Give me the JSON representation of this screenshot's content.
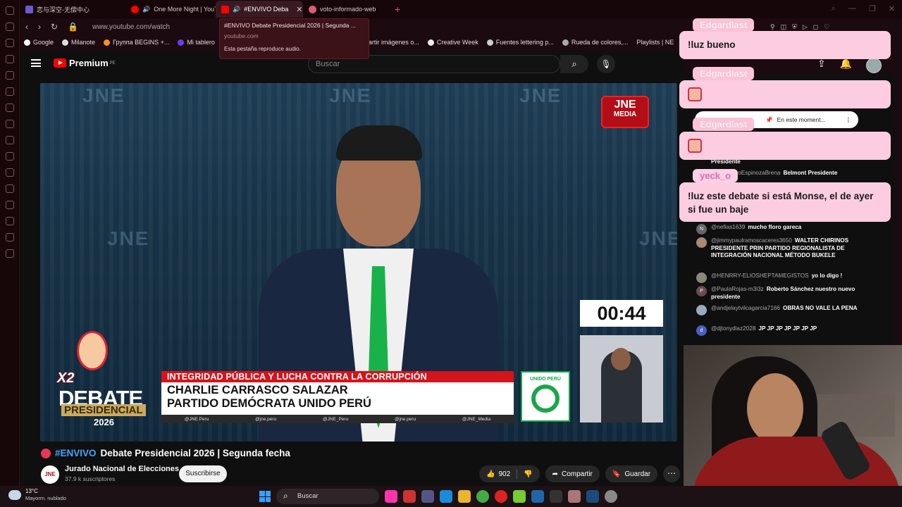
{
  "browser": {
    "tabs": [
      {
        "label": "恋与深空-无偿中心",
        "color": "#6a5acd"
      },
      {
        "label": "One More Night | YouT",
        "color": "#ff0000"
      },
      {
        "label": "#ENVIVO Deba",
        "color": "#ff0000",
        "active": true
      },
      {
        "label": "voto-informado-web",
        "color": "#e05a78"
      }
    ],
    "new_tab": "+",
    "url": "www.youtube.com/watch",
    "bookmarks": [
      "Google",
      "Milanote",
      "Группа BEGINS +...",
      "Mi tablero",
      "Partir imágenes o...",
      "Creative Week",
      "Fuentes lettering p...",
      "Rueda de colores,...",
      "Playlists | NE"
    ],
    "tooltip": {
      "title": "#ENVIVO Debate Presidencial 2026 | Segunda ...",
      "domain": "youtube.com",
      "note": "Esta pestaña reproduce audio."
    }
  },
  "youtube": {
    "logo": "Premium",
    "logo_sup": "PE",
    "search_placeholder": "Buscar",
    "video": {
      "watermark": "JNE",
      "jne_logo": "JNE",
      "jne_logo_sub": "MEDIA",
      "timer": "00:44",
      "debate_x2": "X2",
      "debate_word": "DEBATE",
      "debate_pres": "PRESIDENCIAL",
      "debate_year": "2026",
      "topic": "INTEGRIDAD PÚBLICA Y LUCHA CONTRA LA CORRUPCIÓN",
      "candidate": "CHARLIE CARRASCO SALAZAR",
      "party": "PARTIDO DEMÓCRATA UNIDO PERÚ",
      "socials": [
        "@JNE.Peru",
        "@jne.peru",
        "@JNE_Peru",
        "@jne.peru",
        "@JNE_Media"
      ],
      "party_logo_text": "UNIDO PERÚ"
    },
    "title_hash": "#ENVIVO",
    "title_rest": "Debate Presidencial 2026 | Segunda fecha",
    "channel": {
      "avatar": "JNE",
      "name": "Jurado Nacional de Elecciones",
      "subs": "37.9 k suscriptores"
    },
    "subscribe": "Suscribirse",
    "likes": "902",
    "share": "Compartir",
    "save": "Guardar",
    "more": "⋯"
  },
  "chat": {
    "pinned": "En este moment...",
    "messages": [
      {
        "author": "",
        "text": "Presidente",
        "avatar_color": "#0f0f0f",
        "avatar_text": ""
      },
      {
        "author": "@AlejandroEspinozaBrena",
        "text": "Belmont Presidente",
        "avatar_color": "#5a4",
        "avatar_text": ""
      },
      {
        "author": "@nefias1639",
        "text": "mucho floro gareca",
        "avatar_color": "#666",
        "avatar_text": "N"
      },
      {
        "author": "@jimmypaulramoscaceres3650",
        "text": "WALTER CHIRINOS PRESIDENTE PRIN PARTIDO REGIONALISTA DE INTEGRACIÓN NACIONAL MÉTODO BUKELE",
        "avatar_color": "#a87",
        "avatar_text": ""
      },
      {
        "author": "@HENRRY-ELIOSHEPTAMEGISTOS",
        "text": "yo lo digo !",
        "avatar_color": "#887",
        "avatar_text": ""
      },
      {
        "author": "@PaulaRojas-m3i3z",
        "text": "Roberto Sánchez nuestro nuevo presidente",
        "avatar_color": "#6b4a52",
        "avatar_text": "P"
      },
      {
        "author": "@andjelaytvilcagarcia7166",
        "text": "OBRAS NO VALE LA PENA",
        "avatar_color": "#9ab",
        "avatar_text": ""
      },
      {
        "author": "@djtonydiaz2028",
        "text": "JP JP JP JP JP JP JP",
        "avatar_color": "#4a5fc1",
        "avatar_text": "d"
      }
    ],
    "overlays": [
      {
        "name": "Edgardlast",
        "text": "!luz bueno"
      },
      {
        "name": "Edgardlast",
        "text": ""
      },
      {
        "name": "Edgardlast",
        "text": ""
      },
      {
        "name": "yeck_o",
        "text": "!luz este debate si está Monse, el de ayer si fue un baje"
      }
    ]
  },
  "taskbar": {
    "temp": "13°C",
    "weather": "Mayorm. nublado",
    "search": "Buscar"
  }
}
